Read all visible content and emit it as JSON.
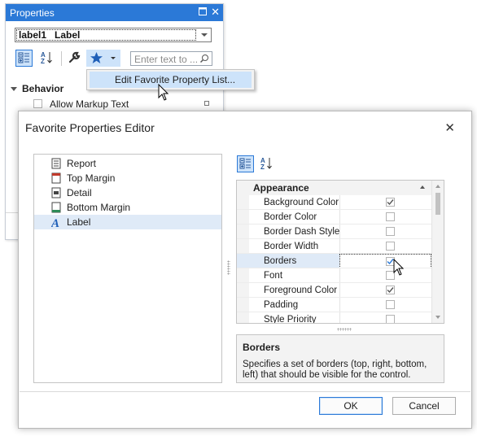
{
  "properties_panel": {
    "title": "Properties",
    "object_selector": "label1   Label",
    "search_placeholder": "Enter text to ...",
    "category": "Behavior",
    "row_label": "Allow Markup Text"
  },
  "popup_menu": {
    "item": "Edit Favorite Property List..."
  },
  "dialog": {
    "title": "Favorite Properties Editor",
    "tree": [
      {
        "label": "Report",
        "icon": "report-icon"
      },
      {
        "label": "Top Margin",
        "icon": "top-margin-icon"
      },
      {
        "label": "Detail",
        "icon": "detail-icon"
      },
      {
        "label": "Bottom Margin",
        "icon": "bottom-margin-icon"
      },
      {
        "label": "Label",
        "icon": "label-icon",
        "selected": true
      }
    ],
    "grid": {
      "category": "Appearance",
      "rows": [
        {
          "name": "Background Color",
          "checked": true
        },
        {
          "name": "Border Color",
          "checked": false
        },
        {
          "name": "Border Dash Style",
          "checked": false
        },
        {
          "name": "Border Width",
          "checked": false
        },
        {
          "name": "Borders",
          "checked": true,
          "selected": true
        },
        {
          "name": "Font",
          "checked": false
        },
        {
          "name": "Foreground Color",
          "checked": true
        },
        {
          "name": "Padding",
          "checked": false
        },
        {
          "name": "Style Priority",
          "checked": false
        }
      ]
    },
    "description": {
      "title": "Borders",
      "text": "Specifies a set of borders (top, right, bottom, left) that should be visible for the control."
    },
    "buttons": {
      "ok": "OK",
      "cancel": "Cancel"
    }
  },
  "colors": {
    "accent": "#2b79d7",
    "selection": "#cde3fa",
    "row_selection": "#dfeaf7"
  }
}
